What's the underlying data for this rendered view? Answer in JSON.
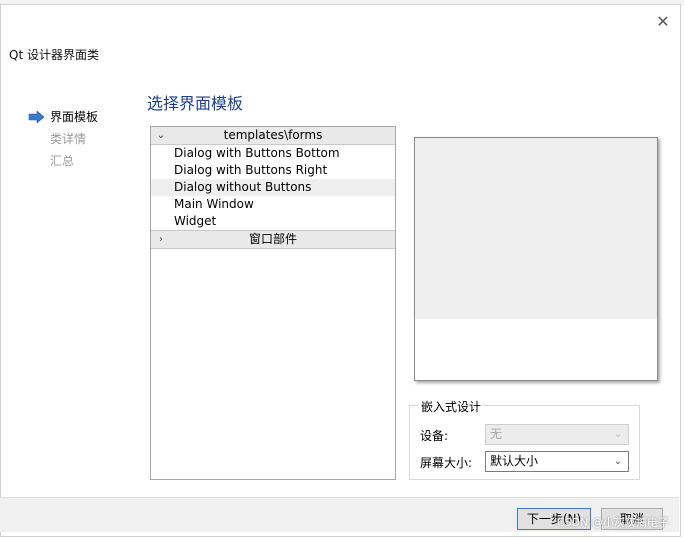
{
  "window": {
    "title": "Qt 设计器界面类",
    "close_icon": "close-icon"
  },
  "steps": [
    {
      "label": "界面模板",
      "state": "active",
      "icon": "arrow-right-icon"
    },
    {
      "label": "类详情",
      "state": "inactive"
    },
    {
      "label": "汇总",
      "state": "inactive"
    }
  ],
  "page_heading": "选择界面模板",
  "tree": {
    "groups": [
      {
        "label": "templates\\forms",
        "expanded": true,
        "icon": "chevron-down-icon",
        "items": [
          "Dialog with Buttons Bottom",
          "Dialog with Buttons Right",
          "Dialog without Buttons",
          "Main Window",
          "Widget"
        ],
        "highlighted_index": 2
      },
      {
        "label": "窗口部件",
        "expanded": false,
        "icon": "chevron-right-icon"
      }
    ]
  },
  "embedded_design": {
    "title": "嵌入式设计",
    "device_label": "设备:",
    "device_value": "无",
    "screen_size_label": "屏幕大小:",
    "screen_size_value": "默认大小"
  },
  "buttons": {
    "next": "下一步(N)",
    "cancel": "取消"
  },
  "watermark": "CSDN @小灰灰搞电子",
  "colors": {
    "heading": "#1d3f8f",
    "arrow": "#3a78c9",
    "default_button_border": "#3d7bd5"
  }
}
